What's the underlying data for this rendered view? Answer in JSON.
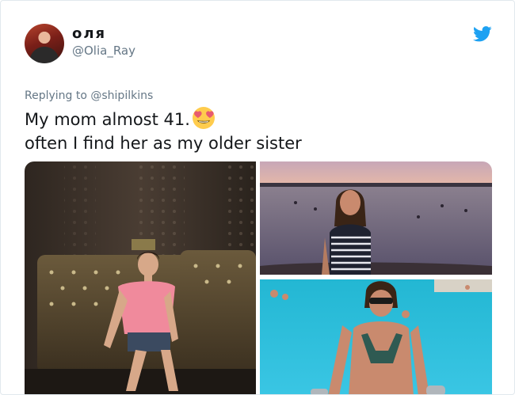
{
  "tweet": {
    "display_name": "оля",
    "handle": "@Olia_Ray",
    "replying_to": "Replying to @shipilkins",
    "text_line1": "My mom almost 41.",
    "text_line2": "often I find her as my older sister",
    "emoji": "smiling-face-with-heart-eyes"
  },
  "colors": {
    "brand": "#1da1f2",
    "secondary_text": "#657786",
    "primary_text": "#14171a"
  },
  "media": {
    "count": 3
  }
}
